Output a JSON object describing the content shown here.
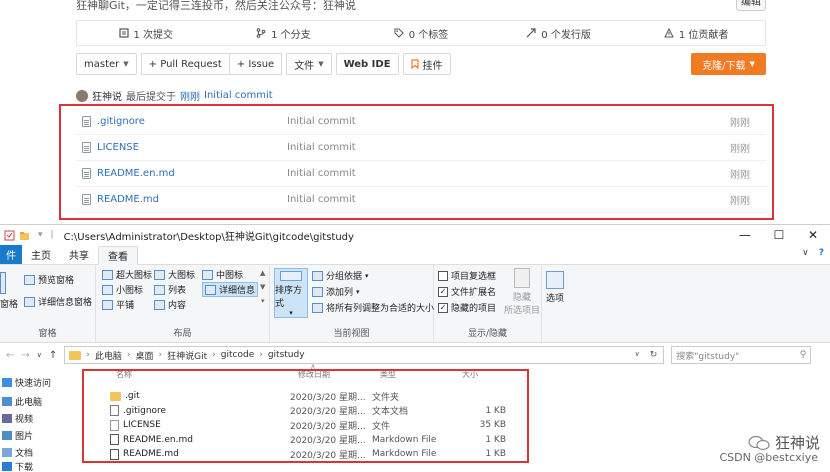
{
  "repo": {
    "description": "狂神聊Git，一定记得三连投币，然后关注公众号：狂神说",
    "edit_label": "编辑",
    "stats": [
      {
        "icon": "commit-icon",
        "label": "1 次提交"
      },
      {
        "icon": "branch-icon",
        "label": "1 个分支"
      },
      {
        "icon": "tag-icon",
        "label": "0 个标签"
      },
      {
        "icon": "release-icon",
        "label": "0 个发行版"
      },
      {
        "icon": "contributor-icon",
        "label": "1 位贡献者"
      }
    ],
    "toolbar": {
      "branch": "master",
      "pull_request": "+ Pull Request",
      "issue": "+ Issue",
      "file": "文件",
      "web_ide": "Web IDE",
      "widget": "挂件",
      "clone": "克隆/下载"
    },
    "commit": {
      "author": "狂神说",
      "text": "最后提交于",
      "time": "刚刚",
      "message": "Initial commit"
    },
    "files": [
      {
        "name": ".gitignore",
        "message": "Initial commit",
        "time": "刚刚"
      },
      {
        "name": "LICENSE",
        "message": "Initial commit",
        "time": "刚刚"
      },
      {
        "name": "README.en.md",
        "message": "Initial commit",
        "time": "刚刚"
      },
      {
        "name": "README.md",
        "message": "Initial commit",
        "time": "刚刚"
      }
    ],
    "colors": {
      "link": "#2d6fb8",
      "accent": "#f27a22",
      "highlight": "#d9343a"
    }
  },
  "explorer": {
    "title_path": "C:\\Users\\Administrator\\Desktop\\狂神说Git\\gitcode\\gitstudy",
    "tabs": {
      "file": "件",
      "home": "主页",
      "share": "共享",
      "view": "查看"
    },
    "ribbon": {
      "pane": {
        "preview": "预览窗格",
        "details": "详细信息窗格",
        "left_cut": "窗格",
        "label": "窗格"
      },
      "layout": {
        "extra_large": "超大图标",
        "large": "大图标",
        "medium": "中图标",
        "small": "小图标",
        "list": "列表",
        "details": "详细信息",
        "tiles": "平铺",
        "content": "内容",
        "label": "布局"
      },
      "view": {
        "sort_by": "排序方式",
        "group_by": "分组依据",
        "add_columns": "添加列",
        "fit_columns": "将所有列调整为合适的大小",
        "label": "当前视图"
      },
      "show_hide": {
        "item_checkboxes": "项目复选框",
        "extensions": "文件扩展名",
        "hidden_items": "隐藏的项目",
        "hide": "隐藏",
        "hide_selected": "所选项目",
        "options": "选项",
        "label": "显示/隐藏"
      }
    },
    "breadcrumb": [
      "此电脑",
      "桌面",
      "狂神说Git",
      "gitcode",
      "gitstudy"
    ],
    "search_placeholder": "搜索\"gitstudy\"",
    "nav": [
      "快速访问",
      "此电脑",
      "视频",
      "图片",
      "文档",
      "下载"
    ],
    "columns": {
      "name": "名称",
      "date": "修改日期",
      "type": "类型",
      "size": "大小"
    },
    "files": [
      {
        "name": ".git",
        "date": "2020/3/20 星期...",
        "type": "文件夹",
        "size": "",
        "kind": "folder"
      },
      {
        "name": ".gitignore",
        "date": "2020/3/20 星期...",
        "type": "文本文档",
        "size": "1 KB",
        "kind": "text"
      },
      {
        "name": "LICENSE",
        "date": "2020/3/20 星期...",
        "type": "文件",
        "size": "35 KB",
        "kind": "file"
      },
      {
        "name": "README.en.md",
        "date": "2020/3/20 星期...",
        "type": "Markdown File",
        "size": "1 KB",
        "kind": "md"
      },
      {
        "name": "README.md",
        "date": "2020/3/20 星期...",
        "type": "Markdown File",
        "size": "1 KB",
        "kind": "md"
      }
    ]
  },
  "watermark": {
    "name": "狂神说",
    "csdn": "CSDN @bestcxiye"
  }
}
